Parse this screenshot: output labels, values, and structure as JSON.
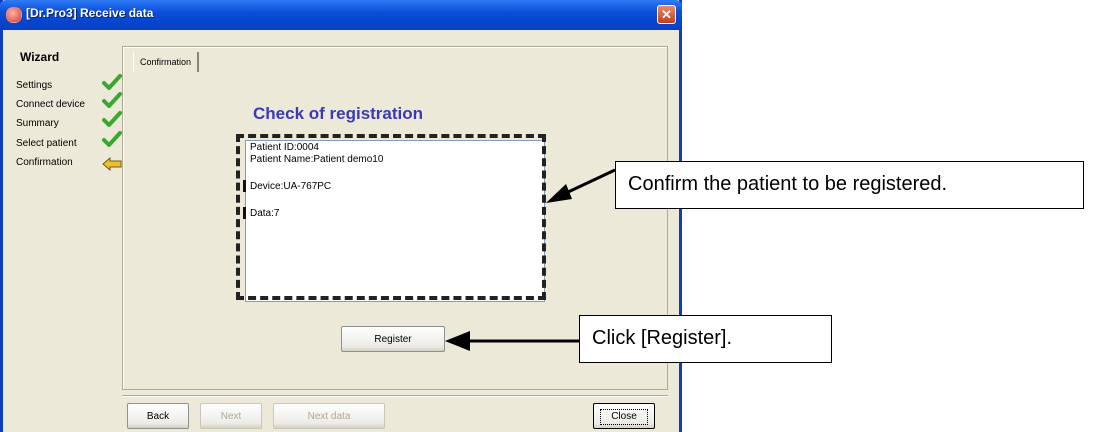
{
  "window": {
    "title": "[Dr.Pro3] Receive data",
    "close_glyph": "✕"
  },
  "sidebar": {
    "title": "Wizard",
    "steps": [
      {
        "label": "Settings",
        "status": "check-icon"
      },
      {
        "label": "Connect device",
        "status": "check-icon"
      },
      {
        "label": "Summary",
        "status": "check-icon"
      },
      {
        "label": "Select patient",
        "status": "check-icon"
      },
      {
        "label": "Confirmation",
        "status": "current-arrow-icon"
      }
    ]
  },
  "main": {
    "tab_label": "Confirmation",
    "heading": "Check of registration",
    "info": {
      "patient_id": "Patient ID:0004",
      "patient_name": "Patient Name:Patient demo10",
      "device": "Device:UA-767PC",
      "data": "Data:7"
    },
    "register_label": "Register"
  },
  "footer": {
    "back_label": "Back",
    "next_label": "Next",
    "next_data_label": "Next data",
    "close_label": "Close"
  },
  "annotations": {
    "confirm_note": "Confirm the patient to be registered.",
    "register_note": "Click [Register]."
  },
  "colors": {
    "heading": "#3a3ab8",
    "check": "#3aa82e",
    "arrow": "#e8c030",
    "titlebar": "#0a4ed8"
  }
}
